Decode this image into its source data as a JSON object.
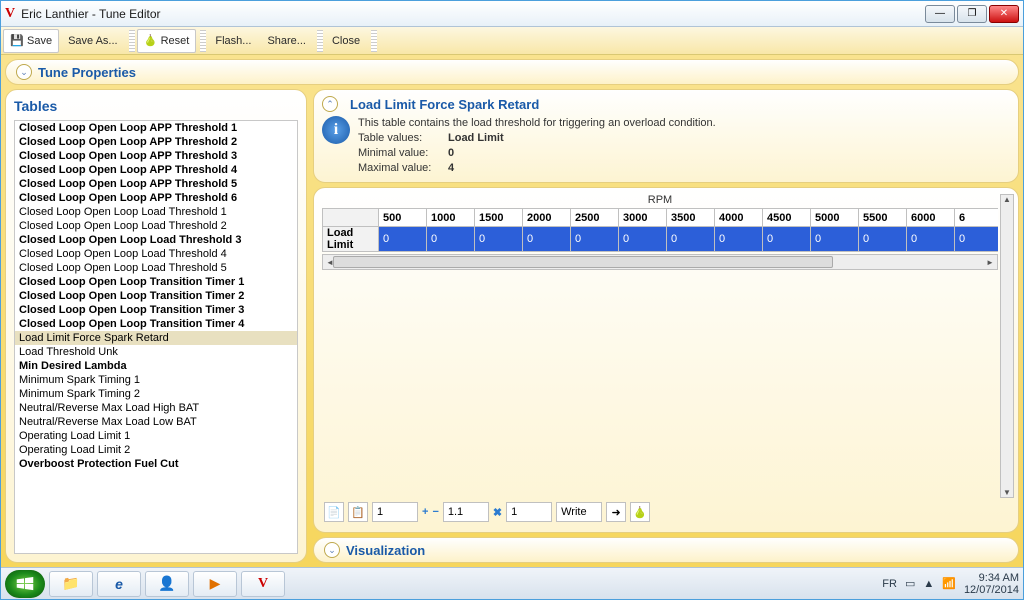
{
  "window_title": "Eric Lanthier - Tune Editor",
  "toolbar": {
    "save": "Save",
    "save_as": "Save As...",
    "reset": "Reset",
    "flash": "Flash...",
    "share": "Share...",
    "close": "Close"
  },
  "tune_properties_label": "Tune Properties",
  "tables_label": "Tables",
  "tables": [
    {
      "label": "Closed Loop Open Loop APP Threshold 1",
      "bold": true
    },
    {
      "label": "Closed Loop Open Loop APP Threshold 2",
      "bold": true
    },
    {
      "label": "Closed Loop Open Loop APP Threshold 3",
      "bold": true
    },
    {
      "label": "Closed Loop Open Loop APP Threshold 4",
      "bold": true
    },
    {
      "label": "Closed Loop Open Loop APP Threshold 5",
      "bold": true
    },
    {
      "label": "Closed Loop Open Loop APP Threshold 6",
      "bold": true
    },
    {
      "label": "Closed Loop Open Loop Load Threshold 1",
      "bold": false
    },
    {
      "label": "Closed Loop Open Loop Load Threshold 2",
      "bold": false
    },
    {
      "label": "Closed Loop Open Loop Load Threshold 3",
      "bold": true
    },
    {
      "label": "Closed Loop Open Loop Load Threshold 4",
      "bold": false
    },
    {
      "label": "Closed Loop Open Loop Load Threshold 5",
      "bold": false
    },
    {
      "label": "Closed Loop Open Loop Transition Timer 1",
      "bold": true
    },
    {
      "label": "Closed Loop Open Loop Transition Timer 2",
      "bold": true
    },
    {
      "label": "Closed Loop Open Loop Transition Timer 3",
      "bold": true
    },
    {
      "label": "Closed Loop Open Loop Transition Timer 4",
      "bold": true
    },
    {
      "label": "Load Limit Force Spark Retard",
      "bold": false,
      "selected": true
    },
    {
      "label": "Load Threshold Unk",
      "bold": false
    },
    {
      "label": "Min Desired Lambda",
      "bold": true
    },
    {
      "label": "Minimum Spark Timing 1",
      "bold": false
    },
    {
      "label": "Minimum Spark Timing 2",
      "bold": false
    },
    {
      "label": "Neutral/Reverse Max Load High BAT",
      "bold": false
    },
    {
      "label": "Neutral/Reverse Max Load Low BAT",
      "bold": false
    },
    {
      "label": "Operating Load Limit 1",
      "bold": false
    },
    {
      "label": "Operating Load Limit 2",
      "bold": false
    },
    {
      "label": "Overboost Protection Fuel Cut",
      "bold": true
    }
  ],
  "detail": {
    "title": "Load Limit Force Spark Retard",
    "description": "This table contains the load threshold for triggering an overload condition.",
    "values_label": "Table values:",
    "values_value": "Load Limit",
    "min_label": "Minimal value:",
    "min_value": "0",
    "max_label": "Maximal value:",
    "max_value": "4"
  },
  "grid": {
    "axis_label": "RPM",
    "row_header": "Load Limit",
    "columns": [
      "500",
      "1000",
      "1500",
      "2000",
      "2500",
      "3000",
      "3500",
      "4000",
      "4500",
      "5000",
      "5500",
      "6000",
      "6"
    ],
    "values": [
      "0",
      "0",
      "0",
      "0",
      "0",
      "0",
      "0",
      "0",
      "0",
      "0",
      "0",
      "0",
      "0"
    ]
  },
  "bottombar": {
    "step1": "1",
    "step2": "1.1",
    "step3": "1",
    "write": "Write"
  },
  "visualization_label": "Visualization",
  "systray": {
    "lang": "FR",
    "time": "9:34 AM",
    "date": "12/07/2014"
  }
}
